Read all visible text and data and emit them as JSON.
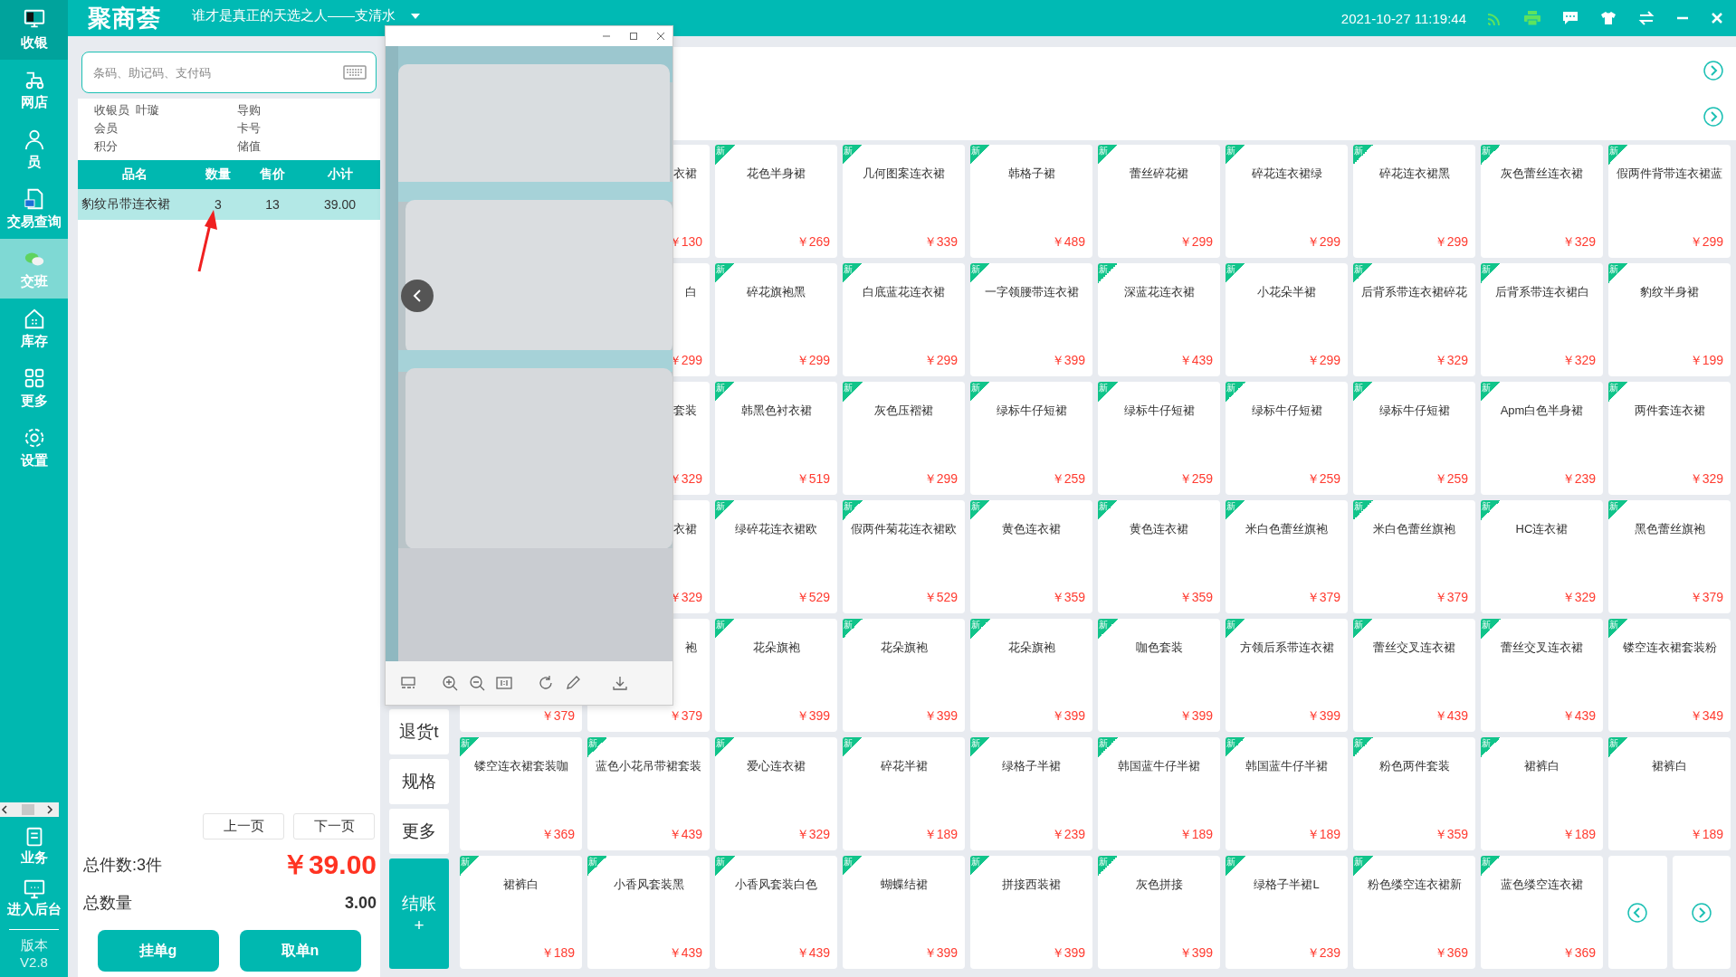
{
  "sidebar": {
    "items": [
      {
        "label": "收银",
        "selected": true,
        "highlighted": false
      },
      {
        "label": "网店",
        "selected": false,
        "highlighted": false
      },
      {
        "label": "员",
        "selected": false,
        "highlighted": false
      },
      {
        "label": "交易查询",
        "selected": false,
        "highlighted": false
      },
      {
        "label": "交班",
        "selected": false,
        "highlighted": true
      },
      {
        "label": "库存",
        "selected": false,
        "highlighted": false
      },
      {
        "label": "更多",
        "selected": false,
        "highlighted": false
      },
      {
        "label": "设置",
        "selected": false,
        "highlighted": false
      }
    ],
    "bottom_items": [
      {
        "label": "业务"
      },
      {
        "label": "进入后台"
      },
      {
        "label": "版本",
        "sub": "V2.8"
      }
    ]
  },
  "top_bar": {
    "logo": "聚商荟",
    "notice": "谁才是真正的天选之人——支清水",
    "datetime": "2021-10-27 11:19:44"
  },
  "order_panel": {
    "search": {
      "placeholder": "条码、助记码、支付码"
    },
    "info": [
      {
        "label": "收银员",
        "value": "叶璇"
      },
      {
        "label": "导购"
      },
      {
        "label": "会员"
      },
      {
        "label": "卡号"
      },
      {
        "label": "积分"
      },
      {
        "label": "储值"
      }
    ],
    "table": {
      "columns": [
        "品名",
        "数量",
        "售价",
        "小计"
      ],
      "rows": [
        {
          "cells": [
            "豹纹吊带连衣裙",
            "3",
            "13",
            "39.00"
          ],
          "selected": true
        }
      ]
    },
    "pager": [
      "上一页",
      "下一页"
    ],
    "total_items": "总件数:3件",
    "total_amount": "￥39.00",
    "total_qty_label": "总数量",
    "total_qty": "3.00",
    "buttons": [
      "挂单g",
      "取单n"
    ]
  },
  "actions": [
    {
      "label": "退货t",
      "kind": "plain"
    },
    {
      "label": "规格",
      "kind": "plain"
    },
    {
      "label": "更多",
      "kind": "plain"
    },
    {
      "label": "结账",
      "sub": "+",
      "kind": "primary"
    }
  ],
  "products": [
    {
      "cells": [
        {
          "kind": "hidden"
        },
        {
          "kind": "partial",
          "name": "衣裙",
          "price": "￥130"
        },
        {
          "kind": "product",
          "badge": "新",
          "name": "花色半身裙",
          "price": "￥269"
        },
        {
          "kind": "product",
          "badge": "新",
          "name": "几何图案连衣裙",
          "price": "￥339"
        },
        {
          "kind": "product",
          "badge": "新",
          "name": "韩格子裙",
          "price": "￥489"
        },
        {
          "kind": "product",
          "badge": "新",
          "name": "蕾丝碎花裙",
          "price": "￥299"
        },
        {
          "kind": "product",
          "badge": "新",
          "name": "碎花连衣裙绿",
          "price": "￥299"
        },
        {
          "kind": "product",
          "badge": "新",
          "name": "碎花连衣裙黑",
          "price": "￥299"
        },
        {
          "kind": "product",
          "badge": "新",
          "name": "灰色蕾丝连衣裙",
          "price": "￥329"
        },
        {
          "kind": "product",
          "badge": "新",
          "name": "假两件背带连衣裙蓝",
          "price": "￥299"
        }
      ]
    },
    {
      "cells": [
        {
          "kind": "hidden"
        },
        {
          "kind": "partial",
          "name": "白",
          "price": "￥299"
        },
        {
          "kind": "product",
          "badge": "新",
          "name": "碎花旗袍黑",
          "price": "￥299"
        },
        {
          "kind": "product",
          "badge": "新",
          "name": "白底蓝花连衣裙",
          "price": "￥299"
        },
        {
          "kind": "product",
          "badge": "新",
          "name": "一字领腰带连衣裙",
          "price": "￥399"
        },
        {
          "kind": "product",
          "badge": "新",
          "name": "深蓝花连衣裙",
          "price": "￥439"
        },
        {
          "kind": "product",
          "badge": "新",
          "name": "小花朵半裙",
          "price": "￥299"
        },
        {
          "kind": "product",
          "badge": "新",
          "name": "后背系带连衣裙碎花",
          "price": "￥329"
        },
        {
          "kind": "product",
          "badge": "新",
          "name": "后背系带连衣裙白",
          "price": "￥329"
        },
        {
          "kind": "product",
          "badge": "新",
          "name": "豹纹半身裙",
          "price": "￥199"
        }
      ]
    },
    {
      "cells": [
        {
          "kind": "hidden"
        },
        {
          "kind": "partial",
          "name": "套装",
          "price": "￥329"
        },
        {
          "kind": "product",
          "badge": "新",
          "name": "韩黑色衬衣裙",
          "price": "￥519"
        },
        {
          "kind": "product",
          "badge": "新",
          "name": "灰色压褶裙",
          "price": "￥299"
        },
        {
          "kind": "product",
          "badge": "新",
          "name": "绿标牛仔短裙",
          "price": "￥259"
        },
        {
          "kind": "product",
          "badge": "新",
          "name": "绿标牛仔短裙",
          "price": "￥259"
        },
        {
          "kind": "product",
          "badge": "新",
          "name": "绿标牛仔短裙",
          "price": "￥259"
        },
        {
          "kind": "product",
          "badge": "新",
          "name": "绿标牛仔短裙",
          "price": "￥259"
        },
        {
          "kind": "product",
          "badge": "新",
          "name": "Apm白色半身裙",
          "price": "￥239"
        },
        {
          "kind": "product",
          "badge": "新",
          "name": "两件套连衣裙",
          "price": "￥329"
        }
      ]
    },
    {
      "cells": [
        {
          "kind": "hidden"
        },
        {
          "kind": "partial",
          "name": "衣裙",
          "price": "￥329"
        },
        {
          "kind": "product",
          "badge": "新",
          "name": "绿碎花连衣裙欧",
          "price": "￥529"
        },
        {
          "kind": "product",
          "badge": "新",
          "name": "假两件菊花连衣裙欧",
          "price": "￥529"
        },
        {
          "kind": "product",
          "badge": "新",
          "name": "黄色连衣裙",
          "price": "￥359"
        },
        {
          "kind": "product",
          "badge": "新",
          "name": "黄色连衣裙",
          "price": "￥359"
        },
        {
          "kind": "product",
          "badge": "新",
          "name": "米白色蕾丝旗袍",
          "price": "￥379"
        },
        {
          "kind": "product",
          "badge": "新",
          "name": "米白色蕾丝旗袍",
          "price": "￥379"
        },
        {
          "kind": "product",
          "badge": "新",
          "name": "HC连衣裙",
          "price": "￥329"
        },
        {
          "kind": "product",
          "badge": "新",
          "name": "黑色蕾丝旗袍",
          "price": "￥379"
        }
      ]
    },
    {
      "cells": [
        {
          "kind": "partial",
          "price": "￥379"
        },
        {
          "kind": "partial",
          "name": "袍",
          "price": "￥379"
        },
        {
          "kind": "product",
          "badge": "新",
          "name": "花朵旗袍",
          "price": "￥399"
        },
        {
          "kind": "product",
          "badge": "新",
          "name": "花朵旗袍",
          "price": "￥399"
        },
        {
          "kind": "product",
          "badge": "新",
          "name": "花朵旗袍",
          "price": "￥399"
        },
        {
          "kind": "product",
          "badge": "新",
          "name": "咖色套装",
          "price": "￥399"
        },
        {
          "kind": "product",
          "badge": "新",
          "name": "方领后系带连衣裙",
          "price": "￥399"
        },
        {
          "kind": "product",
          "badge": "新",
          "name": "蕾丝交叉连衣裙",
          "price": "￥439"
        },
        {
          "kind": "product",
          "badge": "新",
          "name": "蕾丝交叉连衣裙",
          "price": "￥439"
        },
        {
          "kind": "product",
          "badge": "新",
          "name": "镂空连衣裙套装粉",
          "price": "￥349"
        }
      ]
    },
    {
      "cells": [
        {
          "kind": "product",
          "badge": "新",
          "name": "镂空连衣裙套装咖",
          "price": "￥369"
        },
        {
          "kind": "product",
          "badge": "新",
          "name": "蓝色小花吊带裙套装",
          "price": "￥439"
        },
        {
          "kind": "product",
          "badge": "新",
          "name": "爱心连衣裙",
          "price": "￥329"
        },
        {
          "kind": "product",
          "badge": "新",
          "name": "碎花半裙",
          "price": "￥189"
        },
        {
          "kind": "product",
          "badge": "新",
          "name": "绿格子半裙",
          "price": "￥239"
        },
        {
          "kind": "product",
          "badge": "新",
          "name": "韩国蓝牛仔半裙",
          "price": "￥189"
        },
        {
          "kind": "product",
          "badge": "新",
          "name": "韩国蓝牛仔半裙",
          "price": "￥189"
        },
        {
          "kind": "product",
          "badge": "新",
          "name": "粉色两件套装",
          "price": "￥359"
        },
        {
          "kind": "product",
          "badge": "新",
          "name": "裙裤白",
          "price": "￥189"
        },
        {
          "kind": "product",
          "badge": "新",
          "name": "裙裤白",
          "price": "￥189"
        }
      ]
    },
    {
      "cells": [
        {
          "kind": "product",
          "badge": "新",
          "name": "裙裤白",
          "price": "￥189"
        },
        {
          "kind": "product",
          "badge": "新",
          "name": "小香风套装黑",
          "price": "￥439"
        },
        {
          "kind": "product",
          "badge": "新",
          "name": "小香风套装白色",
          "price": "￥439"
        },
        {
          "kind": "product",
          "badge": "新",
          "name": "蝴蝶结裙",
          "price": "￥399"
        },
        {
          "kind": "product",
          "badge": "新",
          "name": "拼接西装裙",
          "price": "￥399"
        },
        {
          "kind": "product",
          "badge": "新",
          "name": "灰色拼接",
          "price": "￥399"
        },
        {
          "kind": "product",
          "badge": "新",
          "name": "绿格子半裙L",
          "price": "￥239"
        },
        {
          "kind": "product",
          "badge": "新",
          "name": "粉色缕空连衣裙新",
          "price": "￥369"
        },
        {
          "kind": "product",
          "badge": "新",
          "name": "蓝色缕空连衣裙",
          "price": "￥369"
        },
        {
          "kind": "pager"
        }
      ]
    }
  ]
}
